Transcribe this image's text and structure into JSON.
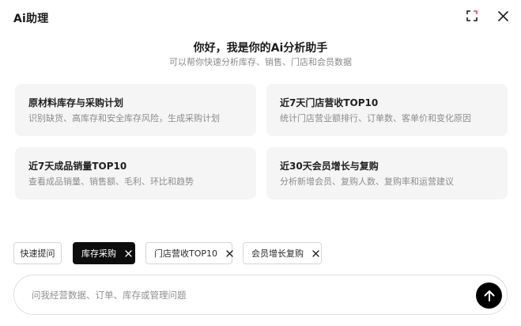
{
  "window": {
    "title": "Ai助理"
  },
  "hero": {
    "greeting": "你好，我是你的Ai分析助手",
    "subtitle": "可以帮你快速分析库存、销售、门店和会员数据"
  },
  "cards": [
    {
      "title": "原材料库存与采购计划",
      "description": "识别缺货、高库存和安全库存风险，生成采购计划"
    },
    {
      "title": "近7天门店营收TOP10",
      "description": "统计门店营业额排行、订单数、客单价和变化原因"
    },
    {
      "title": "近7天成品销量TOP10",
      "description": "查看成品销量、销售额、毛利、环比和趋势"
    },
    {
      "title": "近30天会员增长与复购",
      "description": "分析新增会员、复购人数、复购率和运营建议"
    }
  ],
  "chips": {
    "quick": "快速提问",
    "items": [
      {
        "label": "库存采购",
        "active": true
      },
      {
        "label": "门店营收TOP10",
        "active": false
      },
      {
        "label": "会员增长复购",
        "active": false
      }
    ]
  },
  "input": {
    "placeholder": "问我经营数据、订单、库存或管理问题",
    "value": ""
  },
  "icons": {
    "fullscreen": "fullscreen-icon",
    "close": "close-icon",
    "chip_remove": "close-small-icon",
    "send": "arrow-up-icon"
  },
  "colors": {
    "accent": "#000000",
    "fullscreen_corner_accent": "#e5484d",
    "card_bg": "#f5f5f5"
  }
}
